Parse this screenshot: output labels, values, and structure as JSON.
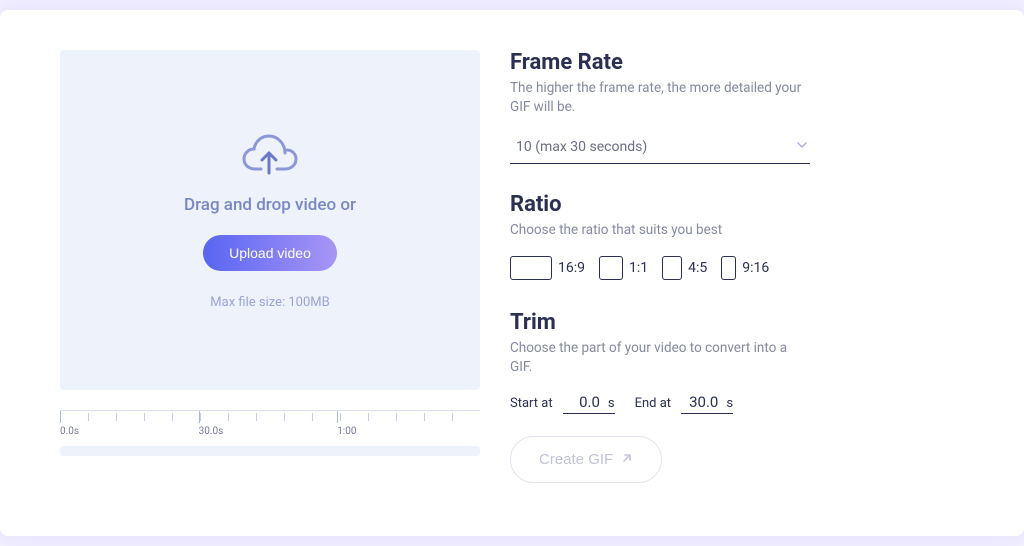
{
  "dropzone": {
    "drop_text": "Drag and drop video or",
    "upload_button_label": "Upload video",
    "max_size_text": "Max file size: 100MB"
  },
  "timeline": {
    "labels": [
      "0.0s",
      "30.0s",
      "1:00"
    ]
  },
  "frame_rate": {
    "title": "Frame Rate",
    "desc": "The higher the frame rate, the more detailed your GIF will be.",
    "selected": "10 (max 30 seconds)"
  },
  "ratio": {
    "title": "Ratio",
    "desc": "Choose the ratio that suits you best",
    "options": [
      {
        "label": "16:9"
      },
      {
        "label": "1:1"
      },
      {
        "label": "4:5"
      },
      {
        "label": "9:16"
      }
    ]
  },
  "trim": {
    "title": "Trim",
    "desc": "Choose the part of your video to convert into a GIF.",
    "start_label": "Start at",
    "start_value": "0.0",
    "end_label": "End at",
    "end_value": "30.0",
    "unit": "s"
  },
  "actions": {
    "create_label": "Create GIF"
  }
}
